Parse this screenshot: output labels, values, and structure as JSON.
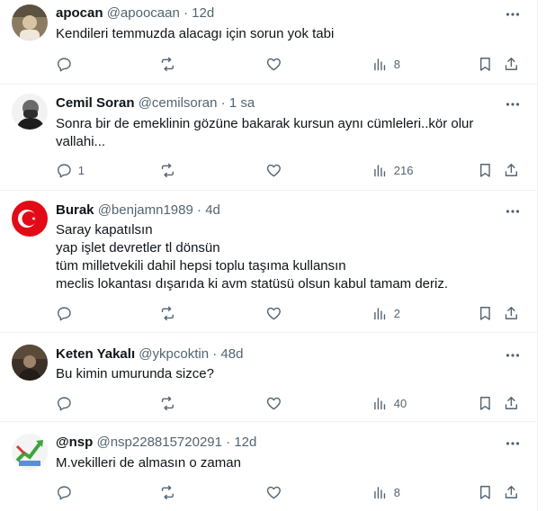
{
  "tweets": [
    {
      "name": "apocan",
      "handle": "@apoocaan",
      "time": "12d",
      "lines": [
        "Kendileri temmuzda alacagı için sorun yok tabi"
      ],
      "replies": "",
      "retweets": "",
      "likes": "",
      "views": "8",
      "avatar_color": "#7a6a55"
    },
    {
      "name": "Cemil Soran",
      "handle": "@cemilsoran",
      "time": "1 sa",
      "lines": [
        "Sonra bir de emeklinin gözüne bakarak kursun aynı cümleleri..kör olur",
        "vallahi..."
      ],
      "replies": "1",
      "retweets": "",
      "likes": "",
      "views": "216",
      "avatar_color": "#3a3a3a"
    },
    {
      "name": "Burak",
      "handle": "@benjamn1989",
      "time": "4d",
      "lines": [
        "Saray kapatılsın",
        "yap işlet devretler tl dönsün",
        "tüm milletvekili dahil hepsi toplu taşıma kullansın",
        "meclis lokantası dışarıda ki avm statüsü olsun kabul tamam deriz."
      ],
      "replies": "",
      "retweets": "",
      "likes": "",
      "views": "2",
      "avatar_color": "#e30a17"
    },
    {
      "name": "Keten Yakalı",
      "handle": "@ykpcoktin",
      "time": "48d",
      "lines": [
        "Bu kimin umurunda sizce?"
      ],
      "replies": "",
      "retweets": "",
      "likes": "",
      "views": "40",
      "avatar_color": "#4a3e32"
    },
    {
      "name": "@nsp",
      "handle": "@nsp228815720291",
      "time": "12d",
      "lines": [
        "M.vekilleri de almasın o zaman"
      ],
      "replies": "",
      "retweets": "",
      "likes": "",
      "views": "8",
      "avatar_color": "#3fa33f"
    }
  ],
  "separator": "·",
  "colors": {
    "text": "#0f1419",
    "secondary": "#536471",
    "divider": "#eff3f4"
  }
}
